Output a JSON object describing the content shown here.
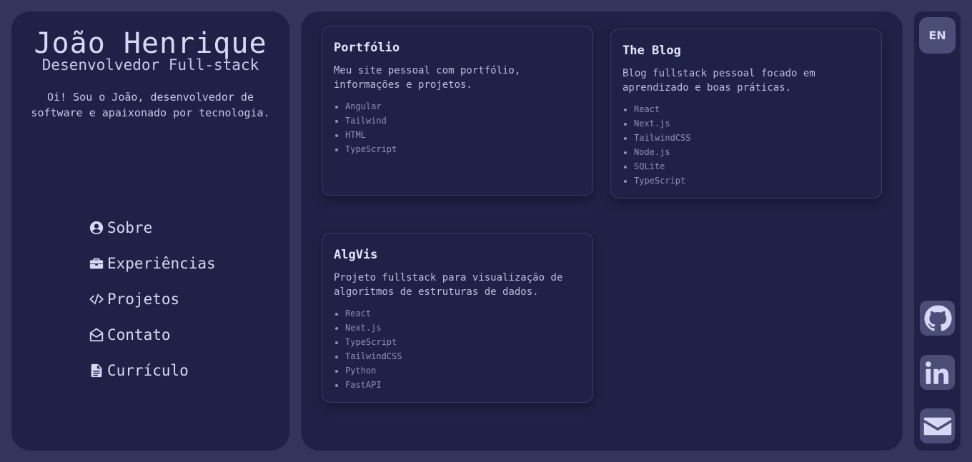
{
  "profile": {
    "name": "João Henrique",
    "role": "Desenvolvedor Full-stack",
    "intro": "Oi! Sou o João, desenvolvedor de software e apaixonado por tecnologia."
  },
  "nav": {
    "items": [
      {
        "label": "Sobre",
        "icon": "user-circle-icon"
      },
      {
        "label": "Experiências",
        "icon": "briefcase-icon"
      },
      {
        "label": "Projetos",
        "icon": "code-icon"
      },
      {
        "label": "Contato",
        "icon": "envelope-open-icon"
      },
      {
        "label": "Currículo",
        "icon": "file-icon"
      }
    ]
  },
  "projects": [
    {
      "title": "Portfólio",
      "description": "Meu site pessoal com portfólio, informações e projetos.",
      "tech": [
        "Angular",
        "Tailwind",
        "HTML",
        "TypeScript"
      ]
    },
    {
      "title": "The Blog",
      "description": "Blog fullstack pessoal focado em aprendizado e boas práticas.",
      "tech": [
        "React",
        "Next.js",
        "TailwindCSS",
        "Node.js",
        "SQLite",
        "TypeScript"
      ]
    },
    {
      "title": "AlgVis",
      "description": "Projeto fullstack para visualização de algoritmos de estruturas de dados.",
      "tech": [
        "React",
        "Next.js",
        "TypeScript",
        "TailwindCSS",
        "Python",
        "FastAPI"
      ]
    }
  ],
  "sidebar_right": {
    "language_label": "EN",
    "social": [
      "github-icon",
      "linkedin-icon",
      "email-icon"
    ]
  },
  "colors": {
    "background": "#33355a",
    "panel": "#1f2246",
    "button": "#4a4d75",
    "text": "#cfd3f0"
  }
}
